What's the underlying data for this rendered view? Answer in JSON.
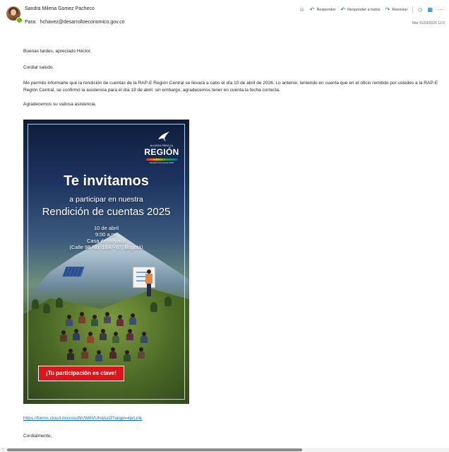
{
  "header": {
    "sender_name": "Sandra Milena Gomez Pacheco",
    "to_label": "Para:",
    "to_address": "hchavez@desarrolloeconomico.gov.co",
    "actions": {
      "reply": "Responder",
      "reply_all": "Responder a todos",
      "forward": "Reenviar"
    },
    "datetime": "Mar 31/03/2026 12:5"
  },
  "icons": {
    "emoji": "smiley-icon",
    "reply": "reply-arrow-icon",
    "reply_all": "reply-all-icon",
    "forward": "forward-arrow-icon",
    "tag": "tag-icon",
    "apps": "apps-grid-icon",
    "more": "more-icon"
  },
  "body": {
    "greeting": "Buenas tardes, apreciado Héctor.",
    "salutation": "Cordial saludo.",
    "paragraph": "Me permito informarte que la rendición de cuentas de la RAP-E Región Central se llevará a cabo el día 10 de abril de 2026. Lo anterior, teniendo en cuenta que en el oficio remitido por ustedes a la RAP-E Región Central, se confirmó la asistencia para el día 19 de abril; sin embargo, agradecemos tener en cuenta la fecha correcta.",
    "thanks": "Agradecemos su valiosa asistencia.",
    "link": "https://forms.cloud.microsoft/r/W6VUhdAzi3?origin=lprLink",
    "closing": "Cordialmente,"
  },
  "poster": {
    "logo_tagline": "ALIANZA PARA LA",
    "logo_name": "REGIÓN",
    "logo_sub": "Rendición de cuentas 2025",
    "headline": "Te invitamos",
    "subhead": "a participar en nuestra",
    "event_title": "Rendición de cuentas 2025",
    "date": "10 de abril",
    "time": "9:00 a.m.",
    "venue": "Casa de Boyacá",
    "address": "(Calle 98 No. 19A - 67, Bogotá)",
    "cta": "¡Tu participación es clave!"
  },
  "colors": {
    "accent": "#0f6cbd",
    "cta_red": "#d9161c",
    "presence": "#6bb700"
  }
}
